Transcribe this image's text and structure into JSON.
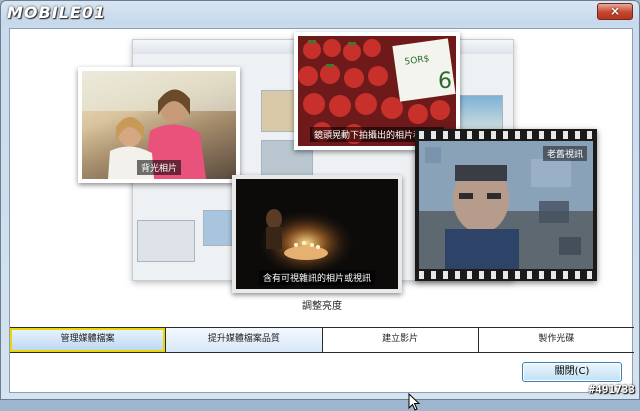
{
  "watermark": {
    "brand": "MOBILE01"
  },
  "window_controls": {
    "close_glyph": "×"
  },
  "photos": {
    "portrait": {
      "caption": "背光相片"
    },
    "strawberries": {
      "caption": "鏡頭晃動下拍攝出的相片和視訊"
    },
    "candles": {
      "caption": "含有可視雜訊的相片或視訊"
    },
    "film": {
      "caption": "老舊視訊"
    }
  },
  "adjust_label": "調整亮度",
  "tabs": [
    {
      "label": "管理媒體檔案",
      "state": "active"
    },
    {
      "label": "提升媒體檔案品質",
      "state": "hover"
    },
    {
      "label": "建立影片",
      "state": "normal"
    },
    {
      "label": "製作光碟",
      "state": "normal"
    }
  ],
  "buttons": {
    "close_label": "關閉(C)"
  },
  "post_id": "#491733",
  "colors": {
    "accent": "#3c7fb1",
    "active_outline": "#e6d800",
    "close_red": "#c7462e"
  },
  "icons": [
    "close-icon",
    "cursor-icon"
  ]
}
